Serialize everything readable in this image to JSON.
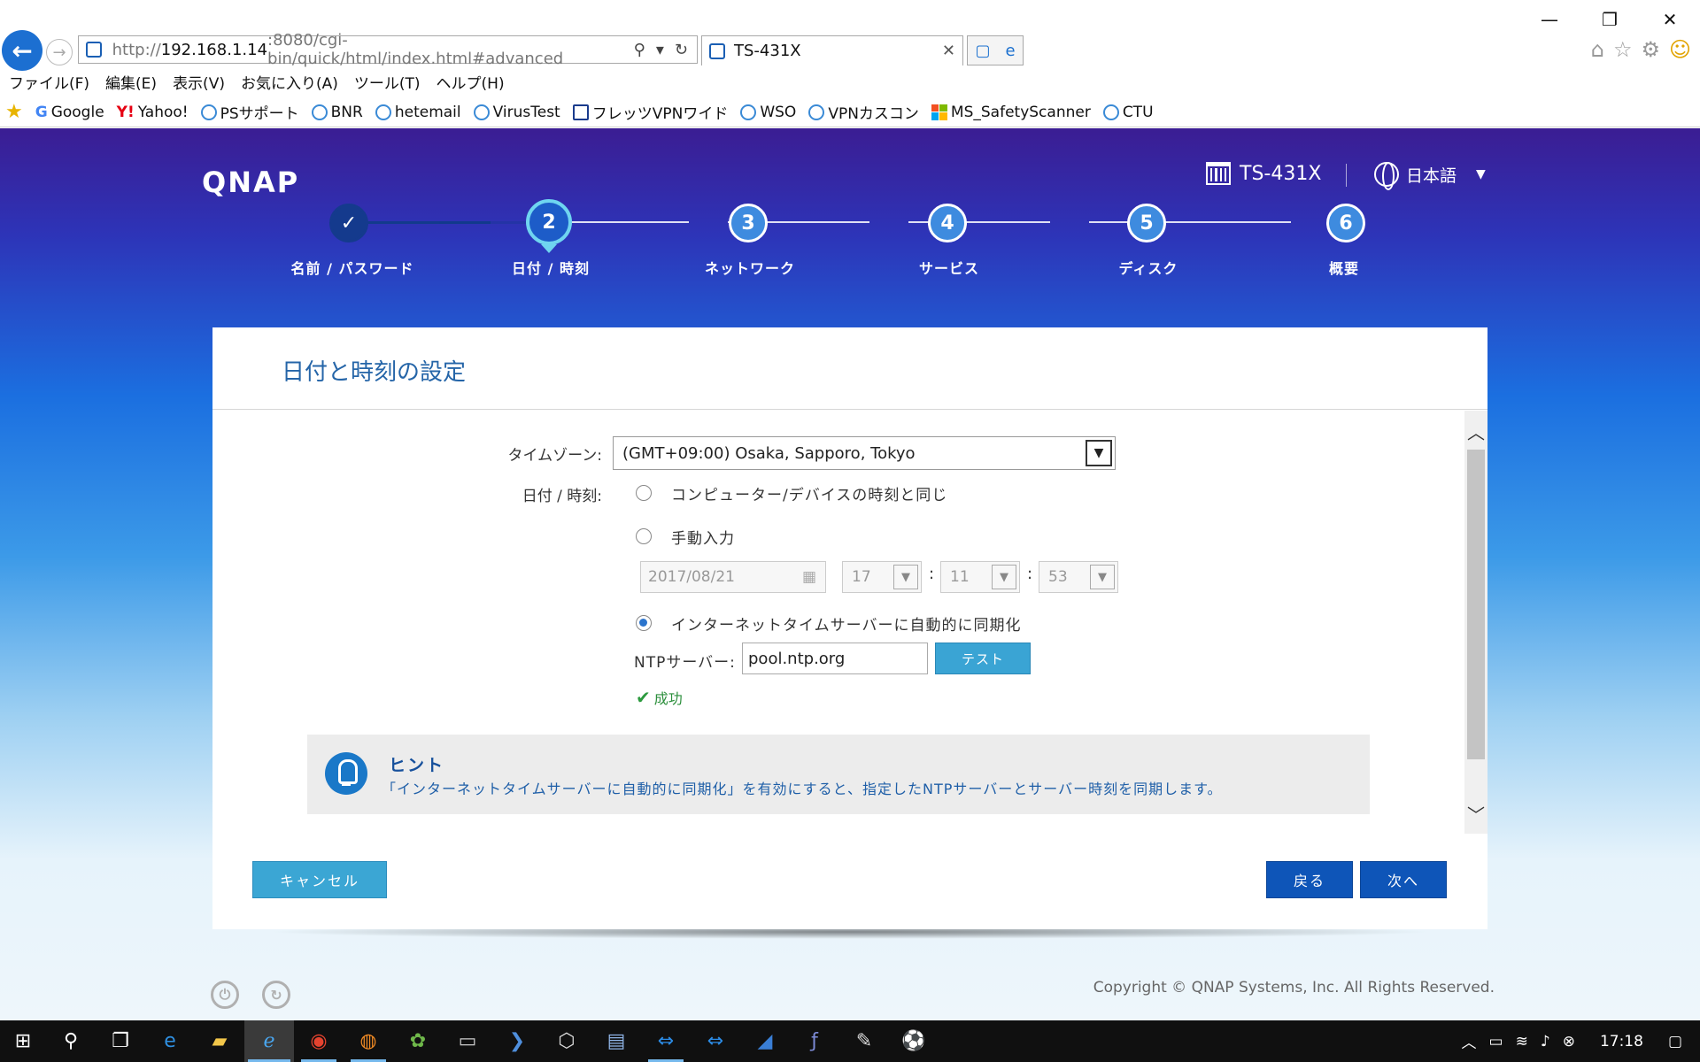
{
  "browser": {
    "url_prefix": "http://",
    "url_host": "192.168.1.14",
    "url_rest": ":8080/cgi-bin/quick/html/index.html#advanced",
    "tab_title": "TS-431X",
    "menu": [
      "ファイル(F)",
      "編集(E)",
      "表示(V)",
      "お気に入り(A)",
      "ツール(T)",
      "ヘルプ(H)"
    ],
    "favorites": [
      "Google",
      "Yahoo!",
      "PSサポート",
      "BNR",
      "hetemail",
      "VirusTest",
      "フレッツVPNワイド",
      "WSO",
      "VPNカスコン",
      "MS_SafetyScanner",
      "CTU"
    ]
  },
  "header": {
    "logo": "QNAP",
    "model": "TS-431X",
    "language": "日本語"
  },
  "steps": [
    {
      "number": "✓",
      "label": "名前 / パスワード",
      "state": "done"
    },
    {
      "number": "2",
      "label": "日付 / 時刻",
      "state": "active"
    },
    {
      "number": "3",
      "label": "ネットワーク",
      "state": "pending"
    },
    {
      "number": "4",
      "label": "サービス",
      "state": "pending"
    },
    {
      "number": "5",
      "label": "ディスク",
      "state": "pending"
    },
    {
      "number": "6",
      "label": "概要",
      "state": "pending"
    }
  ],
  "panel": {
    "title": "日付と時刻の設定",
    "timezone_label": "タイムゾーン:",
    "timezone_value": "(GMT+09:00) Osaka, Sapporo, Tokyo",
    "datetime_label": "日付 / 時刻:",
    "option_same_as_device": "コンピューター/デバイスの時刻と同じ",
    "option_manual": "手動入力",
    "option_ntp": "インターネットタイムサーバーに自動的に同期化",
    "selected_option": "ntp",
    "manual_date": "2017/08/21",
    "manual_hour": "17",
    "manual_minute": "11",
    "manual_second": "53",
    "ntp_label": "NTPサーバー:",
    "ntp_value": "pool.ntp.org",
    "test_button": "テスト",
    "success_text": "成功",
    "hint_title": "ヒント",
    "hint_text": "「インターネットタイムサーバーに自動的に同期化」を有効にすると、指定したNTPサーバーとサーバー時刻を同期します。",
    "cancel_button": "キャンセル",
    "back_button": "戻る",
    "next_button": "次へ"
  },
  "footer": {
    "copyright": "Copyright © QNAP Systems, Inc. All Rights Reserved."
  },
  "taskbar": {
    "clock": "17:18"
  },
  "colors": {
    "accent_blue": "#0e55b8",
    "light_button": "#3ba6d4",
    "title_blue": "#2565a8",
    "success_green": "#2c8f3c"
  }
}
